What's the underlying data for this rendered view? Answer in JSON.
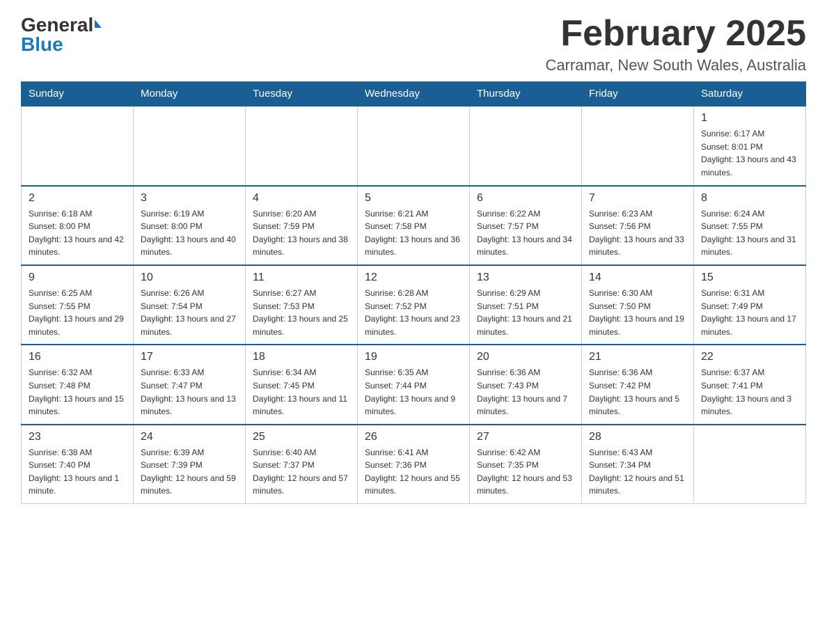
{
  "logo": {
    "general": "General",
    "blue": "Blue"
  },
  "header": {
    "month_title": "February 2025",
    "location": "Carramar, New South Wales, Australia"
  },
  "weekdays": [
    "Sunday",
    "Monday",
    "Tuesday",
    "Wednesday",
    "Thursday",
    "Friday",
    "Saturday"
  ],
  "weeks": [
    {
      "days": [
        {
          "number": "",
          "info": ""
        },
        {
          "number": "",
          "info": ""
        },
        {
          "number": "",
          "info": ""
        },
        {
          "number": "",
          "info": ""
        },
        {
          "number": "",
          "info": ""
        },
        {
          "number": "",
          "info": ""
        },
        {
          "number": "1",
          "info": "Sunrise: 6:17 AM\nSunset: 8:01 PM\nDaylight: 13 hours and 43 minutes."
        }
      ]
    },
    {
      "days": [
        {
          "number": "2",
          "info": "Sunrise: 6:18 AM\nSunset: 8:00 PM\nDaylight: 13 hours and 42 minutes."
        },
        {
          "number": "3",
          "info": "Sunrise: 6:19 AM\nSunset: 8:00 PM\nDaylight: 13 hours and 40 minutes."
        },
        {
          "number": "4",
          "info": "Sunrise: 6:20 AM\nSunset: 7:59 PM\nDaylight: 13 hours and 38 minutes."
        },
        {
          "number": "5",
          "info": "Sunrise: 6:21 AM\nSunset: 7:58 PM\nDaylight: 13 hours and 36 minutes."
        },
        {
          "number": "6",
          "info": "Sunrise: 6:22 AM\nSunset: 7:57 PM\nDaylight: 13 hours and 34 minutes."
        },
        {
          "number": "7",
          "info": "Sunrise: 6:23 AM\nSunset: 7:56 PM\nDaylight: 13 hours and 33 minutes."
        },
        {
          "number": "8",
          "info": "Sunrise: 6:24 AM\nSunset: 7:55 PM\nDaylight: 13 hours and 31 minutes."
        }
      ]
    },
    {
      "days": [
        {
          "number": "9",
          "info": "Sunrise: 6:25 AM\nSunset: 7:55 PM\nDaylight: 13 hours and 29 minutes."
        },
        {
          "number": "10",
          "info": "Sunrise: 6:26 AM\nSunset: 7:54 PM\nDaylight: 13 hours and 27 minutes."
        },
        {
          "number": "11",
          "info": "Sunrise: 6:27 AM\nSunset: 7:53 PM\nDaylight: 13 hours and 25 minutes."
        },
        {
          "number": "12",
          "info": "Sunrise: 6:28 AM\nSunset: 7:52 PM\nDaylight: 13 hours and 23 minutes."
        },
        {
          "number": "13",
          "info": "Sunrise: 6:29 AM\nSunset: 7:51 PM\nDaylight: 13 hours and 21 minutes."
        },
        {
          "number": "14",
          "info": "Sunrise: 6:30 AM\nSunset: 7:50 PM\nDaylight: 13 hours and 19 minutes."
        },
        {
          "number": "15",
          "info": "Sunrise: 6:31 AM\nSunset: 7:49 PM\nDaylight: 13 hours and 17 minutes."
        }
      ]
    },
    {
      "days": [
        {
          "number": "16",
          "info": "Sunrise: 6:32 AM\nSunset: 7:48 PM\nDaylight: 13 hours and 15 minutes."
        },
        {
          "number": "17",
          "info": "Sunrise: 6:33 AM\nSunset: 7:47 PM\nDaylight: 13 hours and 13 minutes."
        },
        {
          "number": "18",
          "info": "Sunrise: 6:34 AM\nSunset: 7:45 PM\nDaylight: 13 hours and 11 minutes."
        },
        {
          "number": "19",
          "info": "Sunrise: 6:35 AM\nSunset: 7:44 PM\nDaylight: 13 hours and 9 minutes."
        },
        {
          "number": "20",
          "info": "Sunrise: 6:36 AM\nSunset: 7:43 PM\nDaylight: 13 hours and 7 minutes."
        },
        {
          "number": "21",
          "info": "Sunrise: 6:36 AM\nSunset: 7:42 PM\nDaylight: 13 hours and 5 minutes."
        },
        {
          "number": "22",
          "info": "Sunrise: 6:37 AM\nSunset: 7:41 PM\nDaylight: 13 hours and 3 minutes."
        }
      ]
    },
    {
      "days": [
        {
          "number": "23",
          "info": "Sunrise: 6:38 AM\nSunset: 7:40 PM\nDaylight: 13 hours and 1 minute."
        },
        {
          "number": "24",
          "info": "Sunrise: 6:39 AM\nSunset: 7:39 PM\nDaylight: 12 hours and 59 minutes."
        },
        {
          "number": "25",
          "info": "Sunrise: 6:40 AM\nSunset: 7:37 PM\nDaylight: 12 hours and 57 minutes."
        },
        {
          "number": "26",
          "info": "Sunrise: 6:41 AM\nSunset: 7:36 PM\nDaylight: 12 hours and 55 minutes."
        },
        {
          "number": "27",
          "info": "Sunrise: 6:42 AM\nSunset: 7:35 PM\nDaylight: 12 hours and 53 minutes."
        },
        {
          "number": "28",
          "info": "Sunrise: 6:43 AM\nSunset: 7:34 PM\nDaylight: 12 hours and 51 minutes."
        },
        {
          "number": "",
          "info": ""
        }
      ]
    }
  ]
}
